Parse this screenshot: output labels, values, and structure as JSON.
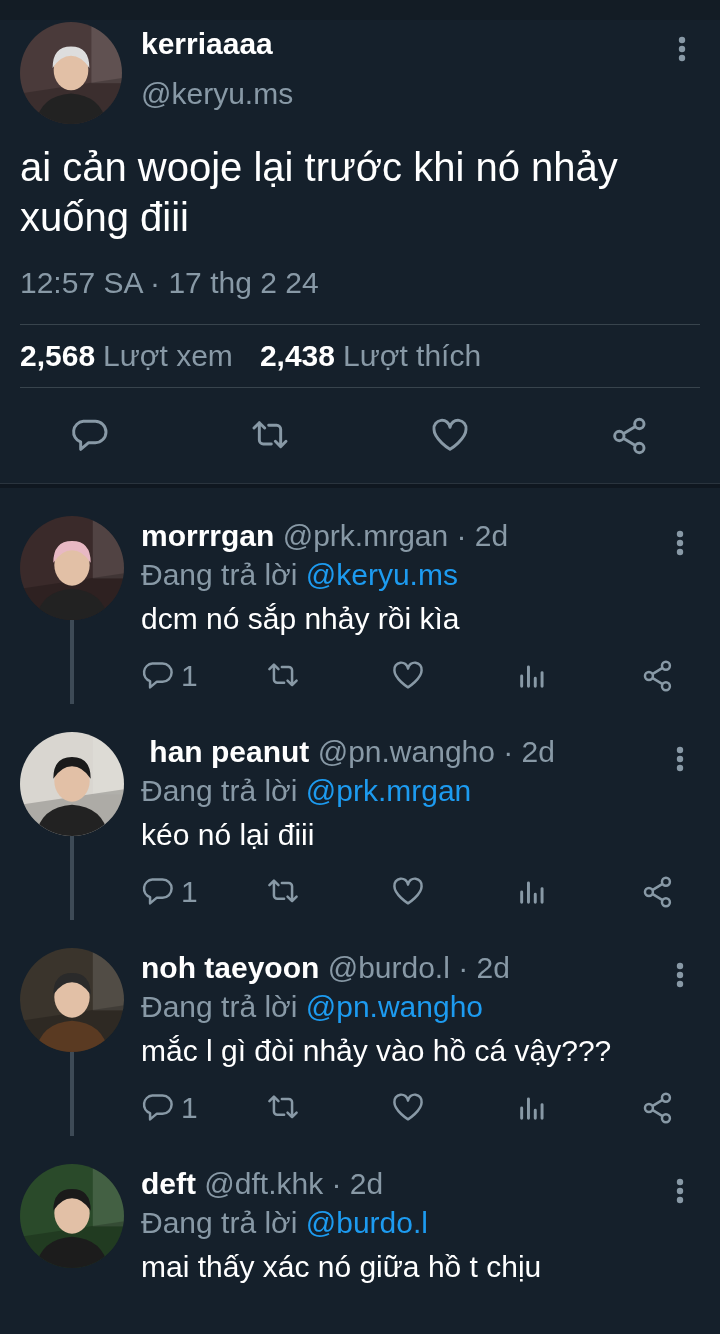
{
  "tweet": {
    "display_name": "kerriaaaa",
    "handle": "@keryu.ms",
    "text": "ai cản wooje lại trước khi nó nhảy xuống điii",
    "timestamp": "12:57 SA · 17 thg 2 24",
    "stats": [
      {
        "count": "2,568",
        "label": "Lượt xem"
      },
      {
        "count": "2,438",
        "label": "Lượt thích"
      }
    ]
  },
  "replies": [
    {
      "display_name": "morrrgan",
      "handle": "@prk.mrgan",
      "age": "· 2d",
      "replying_label": "Đang trả lời",
      "replying_to": "@keryu.ms",
      "text": "dcm nó sắp nhảy rồi kìa",
      "reply_count": "1",
      "thread_line": true
    },
    {
      "display_name": " han peanut",
      "handle": "@pn.wangho",
      "age": "· 2d",
      "replying_label": "Đang trả lời",
      "replying_to": "@prk.mrgan",
      "text": "kéo nó lại điii",
      "reply_count": "1",
      "thread_line": true
    },
    {
      "display_name": "noh taeyoon",
      "handle": "@burdo.l",
      "age": "· 2d",
      "replying_label": "Đang trả lời",
      "replying_to": "@pn.wangho",
      "text": "mắc l gì đòi nhảy vào hồ cá vậy???",
      "reply_count": "1",
      "thread_line": true
    },
    {
      "display_name": "deft",
      "handle": "@dft.khk",
      "age": "· 2d",
      "replying_label": "Đang trả lời",
      "replying_to": "@burdo.l",
      "text": "mai thấy xác nó giữa hồ t chịu",
      "thread_line": false
    }
  ]
}
